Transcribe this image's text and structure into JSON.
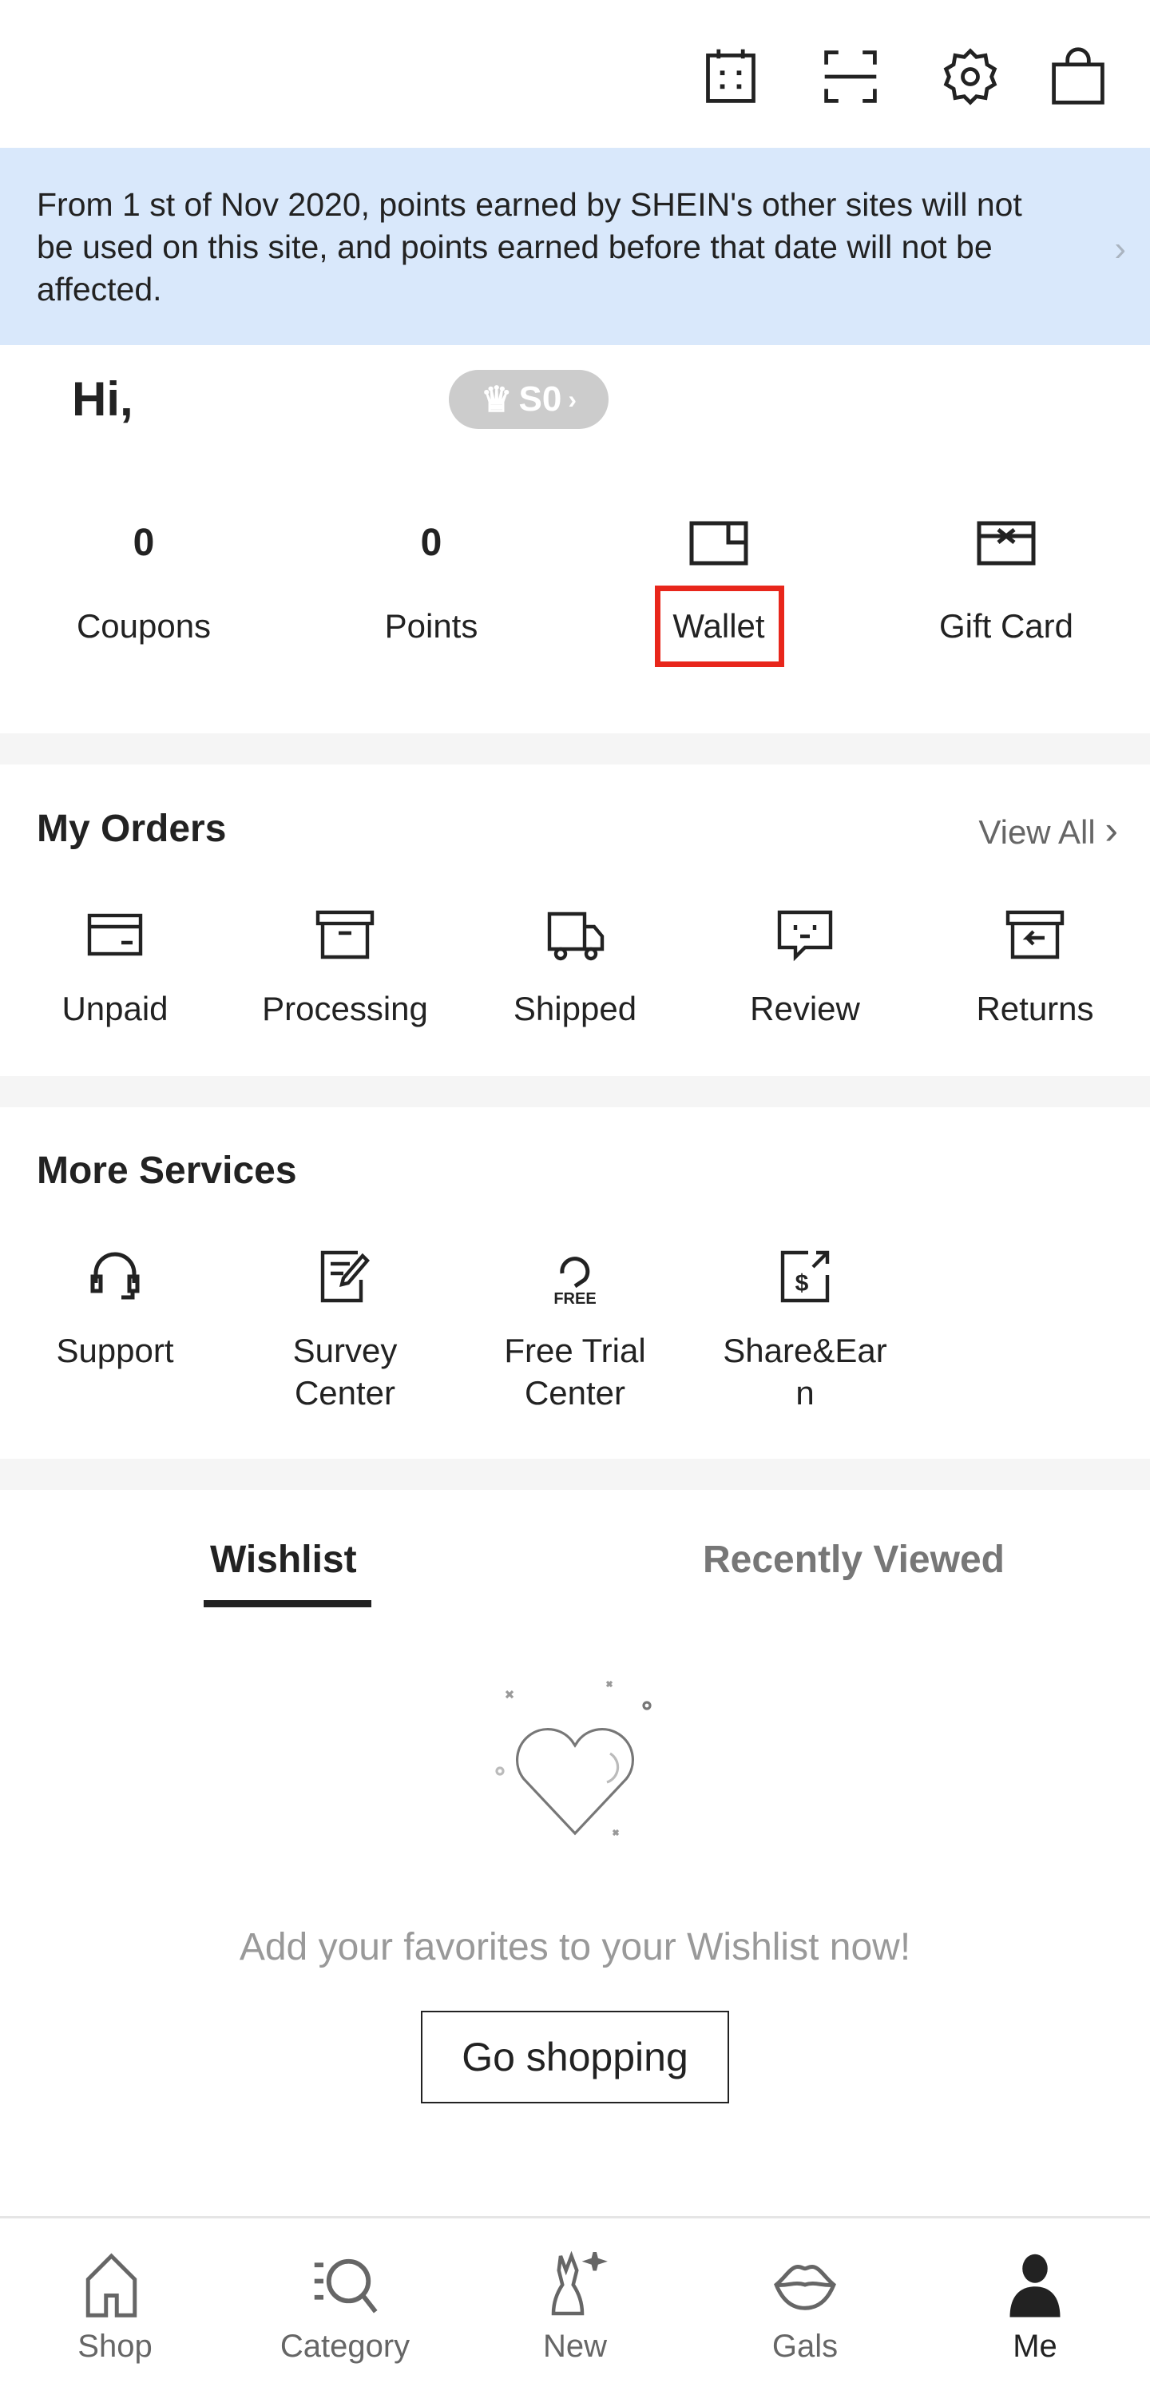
{
  "topbar": {
    "icons": [
      "calendar-icon",
      "scan-icon",
      "gear-icon",
      "bag-icon"
    ]
  },
  "banner": {
    "text": "From 1 st of Nov 2020, points earned by SHEIN's other sites will not be used on this site, and points earned before that date will not be affected."
  },
  "user": {
    "greeting": "Hi,",
    "level": "S0"
  },
  "stats": [
    {
      "value": "0",
      "label": "Coupons"
    },
    {
      "value": "0",
      "label": "Points"
    },
    {
      "label": "Wallet"
    },
    {
      "label": "Gift Card"
    }
  ],
  "orders": {
    "title": "My Orders",
    "view_all": "View All",
    "items": [
      "Unpaid",
      "Processing",
      "Shipped",
      "Review",
      "Returns"
    ]
  },
  "services": {
    "title": "More Services",
    "items": [
      "Support",
      "Survey\nCenter",
      "Free Trial\nCenter",
      "Share&Ear\nn"
    ],
    "free_badge": "FREE"
  },
  "tabs": {
    "wishlist": "Wishlist",
    "recent": "Recently Viewed"
  },
  "empty": {
    "message": "Add your favorites to your Wishlist now!",
    "button": "Go shopping"
  },
  "nav": [
    "Shop",
    "Category",
    "New",
    "Gals",
    "Me"
  ],
  "colors": {
    "banner": "#d9e8fb",
    "highlight": "#e8261b"
  }
}
